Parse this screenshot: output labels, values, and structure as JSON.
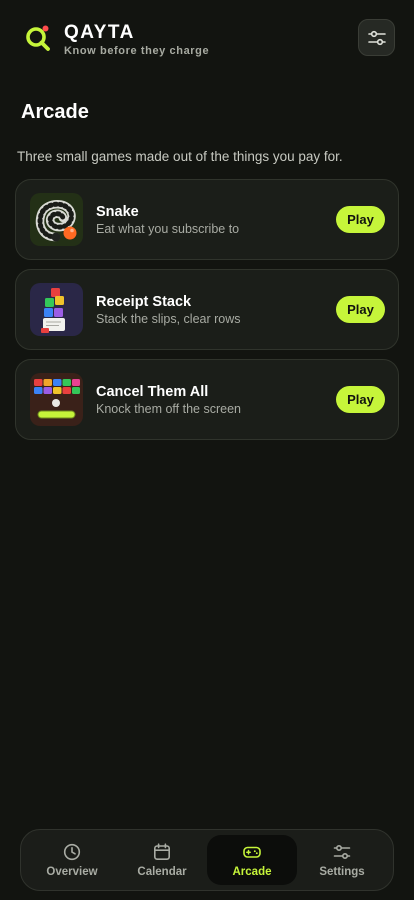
{
  "brand": {
    "name": "QAYTA",
    "tagline": "Know before they charge",
    "accent": "#c6f53a",
    "dot_color": "#ff4d4d"
  },
  "header": {
    "filter_icon": "sliders-icon"
  },
  "page": {
    "title": "Arcade",
    "subtitle": "Three small games made out of the things you pay for."
  },
  "games": [
    {
      "name": "Snake",
      "description": "Eat what you subscribe to",
      "play_label": "Play",
      "icon": "snake-icon"
    },
    {
      "name": "Receipt Stack",
      "description": "Stack the slips, clear rows",
      "play_label": "Play",
      "icon": "receipt-stack-icon"
    },
    {
      "name": "Cancel Them All",
      "description": "Knock them off the screen",
      "play_label": "Play",
      "icon": "brick-breaker-icon"
    }
  ],
  "nav": {
    "items": [
      {
        "label": "Overview",
        "icon": "clock-icon",
        "active": false
      },
      {
        "label": "Calendar",
        "icon": "calendar-icon",
        "active": false
      },
      {
        "label": "Arcade",
        "icon": "gamepad-icon",
        "active": true
      },
      {
        "label": "Settings",
        "icon": "sliders-icon",
        "active": false
      }
    ]
  }
}
